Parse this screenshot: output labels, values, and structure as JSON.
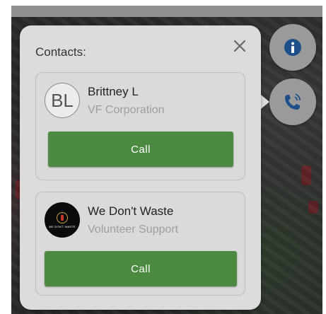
{
  "panel": {
    "title": "Contacts:",
    "close_icon": "close-icon"
  },
  "contacts": [
    {
      "avatar_initials": "BL",
      "name": "Brittney L",
      "organization": "VF Corporation",
      "call_label": "Call"
    },
    {
      "avatar_logo_text": "WE DON'T WASTE",
      "name": "We Don't Waste",
      "organization": "Volunteer Support",
      "call_label": "Call"
    }
  ],
  "side_buttons": [
    {
      "icon": "info-icon"
    },
    {
      "icon": "phone-call-icon"
    }
  ],
  "colors": {
    "call_button": "#4c8a41",
    "panel_bg": "#dcdcdc",
    "side_button_bg": "#9a9a9a",
    "icon_blue": "#1f4f8a"
  }
}
